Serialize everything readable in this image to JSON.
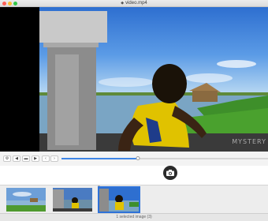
{
  "window": {
    "title": "video.mp4",
    "title_icon": "video-file-icon"
  },
  "video": {
    "watermark": "MYSTERY"
  },
  "controls": {
    "buttons": [
      {
        "name": "settings-gear-icon",
        "glyph": "⚙"
      },
      {
        "name": "volume-icon",
        "glyph": "◀"
      },
      {
        "name": "loop-icon",
        "glyph": "▬"
      },
      {
        "name": "play-icon",
        "glyph": "▶"
      },
      {
        "name": "previous-frame-icon",
        "glyph": "‹"
      },
      {
        "name": "next-frame-icon",
        "glyph": "›"
      }
    ],
    "playback_progress": 0.37
  },
  "snapshot": {
    "icon": "camera-icon"
  },
  "thumbnails": [
    {
      "name": "thumbnail-1",
      "selected": false
    },
    {
      "name": "thumbnail-2",
      "selected": false
    },
    {
      "name": "thumbnail-3",
      "selected": true
    }
  ],
  "status": {
    "text": "1 selected image (3)"
  },
  "colors": {
    "accent": "#3f86e6",
    "selection": "#2e72d8"
  }
}
